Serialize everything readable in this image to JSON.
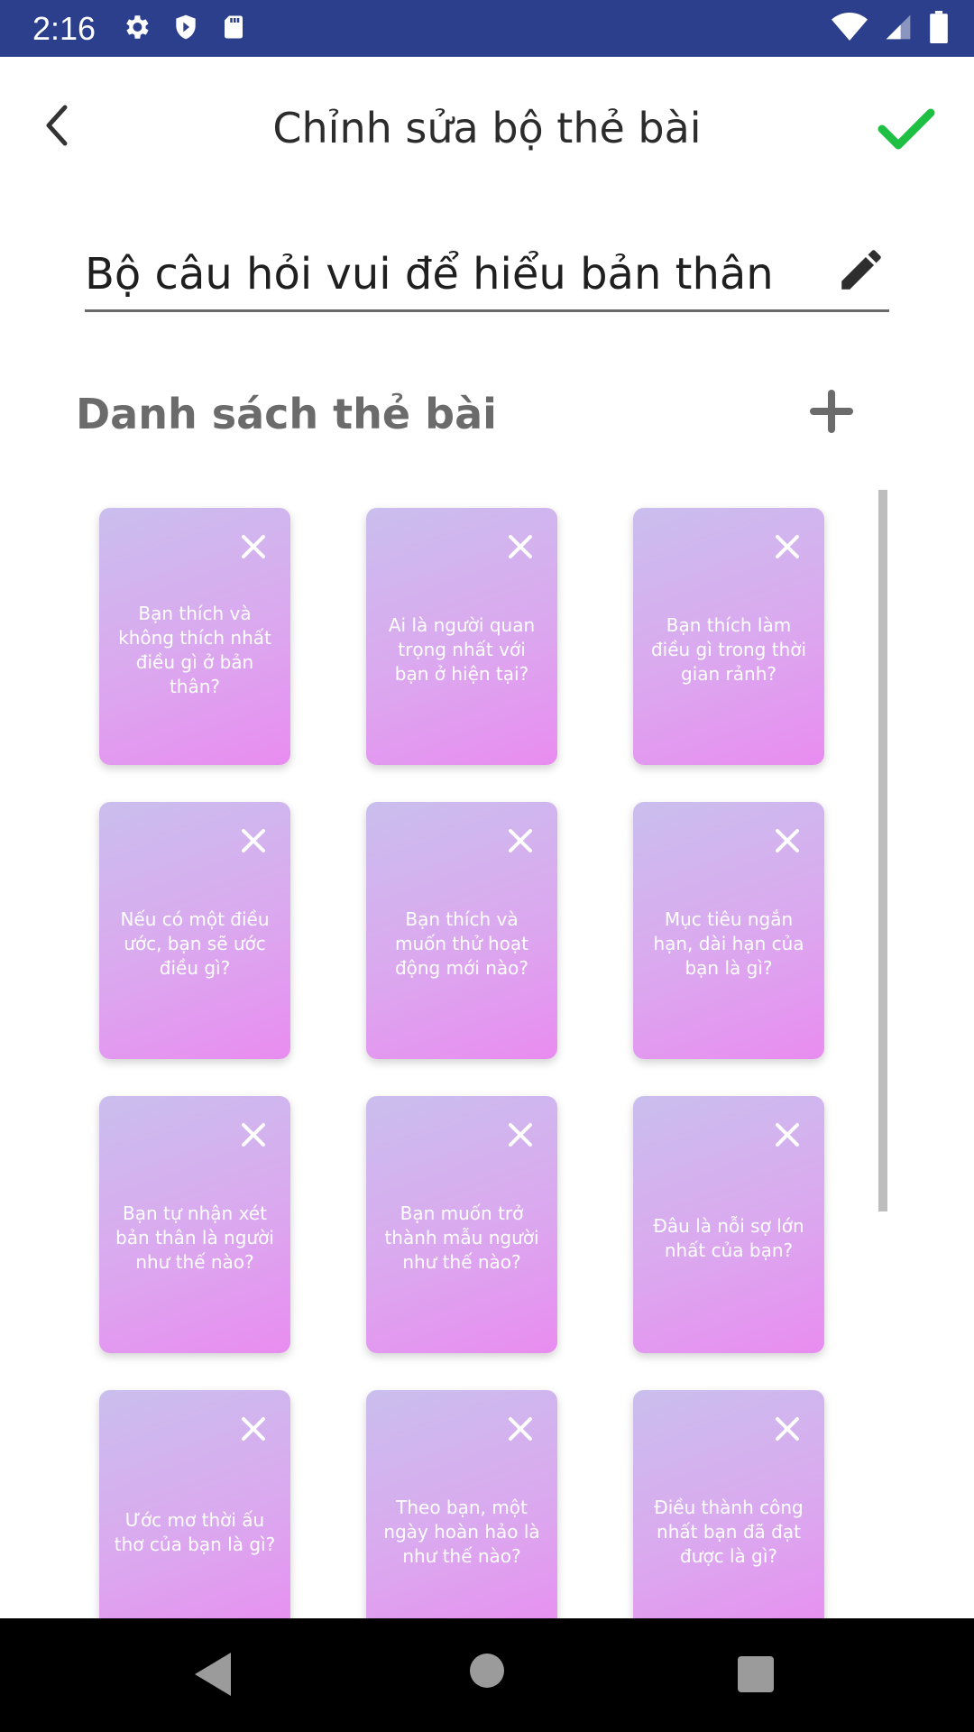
{
  "status_bar": {
    "time": "2:16",
    "icons_left": [
      "settings-icon",
      "shield-icon",
      "sd-card-icon"
    ],
    "icons_right": [
      "wifi-icon",
      "signal-icon",
      "battery-icon"
    ],
    "color": "#2b3f8c"
  },
  "header": {
    "title": "Chỉnh sửa bộ thẻ bài",
    "back_icon": "chevron-left-icon",
    "confirm_icon": "check-icon",
    "confirm_color": "#1ec043"
  },
  "deck": {
    "name": "Bộ câu hỏi vui để hiểu bản thân",
    "edit_icon": "pencil-icon"
  },
  "section": {
    "title": "Danh sách thẻ bài",
    "add_icon": "plus-icon"
  },
  "cards": [
    {
      "text": "Bạn thích và không thích nhất điều gì ở bản thân?"
    },
    {
      "text": "Ai là người quan trọng nhất với bạn ở hiện tại?"
    },
    {
      "text": "Bạn thích làm điều gì trong thời gian rảnh?"
    },
    {
      "text": "Nếu có một điều ước, bạn sẽ ước điều gì?"
    },
    {
      "text": "Bạn thích và muốn thử hoạt động mới nào?"
    },
    {
      "text": "Mục tiêu ngắn hạn, dài hạn của bạn là gì?"
    },
    {
      "text": "Bạn tự nhận xét bản thân là người như thế nào?"
    },
    {
      "text": "Bạn muốn trở thành mẫu người như thế nào?"
    },
    {
      "text": "Đâu là nỗi sợ lớn nhất của bạn?"
    },
    {
      "text": "Ước mơ thời ấu thơ của bạn là gì?"
    },
    {
      "text": "Theo bạn, một ngày hoàn hảo là như thế nào?"
    },
    {
      "text": "Điều thành công nhất bạn đã đạt được là gì?"
    }
  ],
  "nav_bar": {
    "icons": [
      "nav-back-icon",
      "nav-home-icon",
      "nav-recents-icon"
    ]
  }
}
